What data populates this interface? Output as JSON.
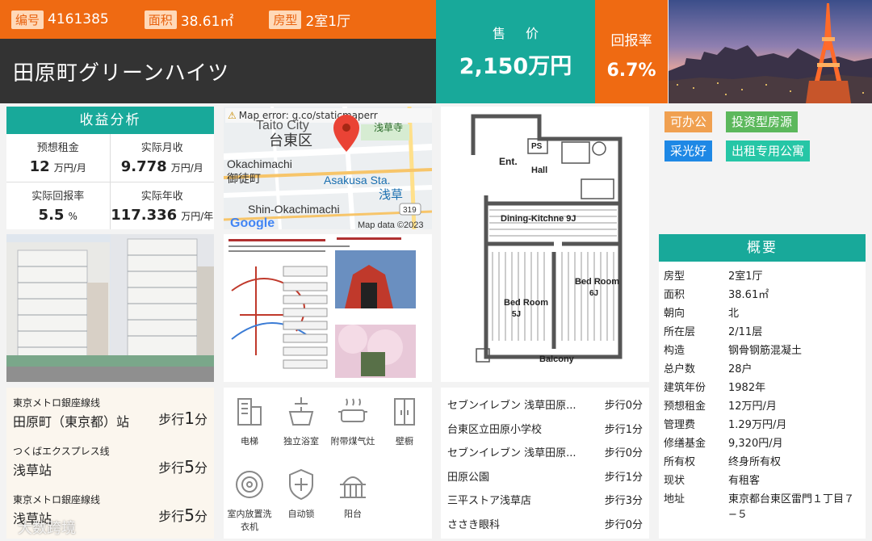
{
  "header": {
    "id_label": "编号",
    "id_value": "4161385",
    "area_label": "面积",
    "area_value": "38.61㎡",
    "layout_label": "房型",
    "layout_value": "2室1厅",
    "name": "田原町グリーンハイツ"
  },
  "price": {
    "label": "售 价",
    "value": "2,150万円"
  },
  "yield": {
    "label": "回报率",
    "value": "6.7%"
  },
  "income": {
    "title": "收益分析",
    "items": [
      {
        "label": "预想租金",
        "value": "12",
        "unit": "万円/月"
      },
      {
        "label": "实际月收",
        "value": "9.778",
        "unit": "万円/月"
      },
      {
        "label": "实际回报率",
        "value": "5.5",
        "unit": "%"
      },
      {
        "label": "实际年收",
        "value": "117.336",
        "unit": "万円/年"
      }
    ]
  },
  "stations": [
    {
      "line": "東京メトロ銀座線线",
      "name": "田原町（東京都）站",
      "walk_prefix": "步行",
      "walk_num": "1",
      "walk_unit": "分"
    },
    {
      "line": "つくばエクスプレス线",
      "name": "浅草站",
      "walk_prefix": "步行",
      "walk_num": "5",
      "walk_unit": "分"
    },
    {
      "line": "東京メトロ銀座線线",
      "name": "浅草站",
      "walk_prefix": "步行",
      "walk_num": "5",
      "walk_unit": "分"
    }
  ],
  "map": {
    "error": "Map error: g.co/staticmaperr",
    "labels": [
      "Taito City",
      "台東区",
      "浅草寺",
      "Okachimachi",
      "御徒町",
      "Asakusa Sta.",
      "浅草",
      "Shin-Okachimachi",
      "319",
      "Google",
      "Map data ©2023"
    ]
  },
  "amenities": [
    {
      "label": "电梯",
      "icon": "elevator-icon"
    },
    {
      "label": "独立浴室",
      "icon": "shower-icon"
    },
    {
      "label": "附带煤气灶",
      "icon": "gas-stove-icon"
    },
    {
      "label": "壁橱",
      "icon": "closet-icon"
    },
    {
      "label": "室内放置洗衣机",
      "icon": "washing-machine-icon"
    },
    {
      "label": "自动锁",
      "icon": "auto-lock-icon"
    },
    {
      "label": "阳台",
      "icon": "balcony-icon"
    }
  ],
  "floorplan": {
    "labels": [
      "PS",
      "Ent.",
      "Hall",
      "Dining-Kitchne 9J",
      "Bed Room",
      "6J",
      "Bed Room",
      "5J",
      "Balcony"
    ]
  },
  "nearby": [
    {
      "name": "セブンイレブン 浅草田原...",
      "walk": "步行0分"
    },
    {
      "name": "台東区立田原小学校",
      "walk": "步行1分"
    },
    {
      "name": "セブンイレブン 浅草田原...",
      "walk": "步行0分"
    },
    {
      "name": "田原公園",
      "walk": "步行1分"
    },
    {
      "name": "三平ストア浅草店",
      "walk": "步行3分"
    },
    {
      "name": "ささき眼科",
      "walk": "步行0分"
    }
  ],
  "tags": [
    {
      "label": "可办公",
      "color": "#f0a050"
    },
    {
      "label": "投资型房源",
      "color": "#5cb85c"
    },
    {
      "label": "采光好",
      "color": "#1e88e5"
    },
    {
      "label": "出租专用公寓",
      "color": "#26c6a6"
    }
  ],
  "overview": {
    "title": "概要",
    "rows": [
      {
        "k": "房型",
        "v": "2室1厅"
      },
      {
        "k": "面积",
        "v": "38.61㎡"
      },
      {
        "k": "朝向",
        "v": "北"
      },
      {
        "k": "所在层",
        "v": "2/11层"
      },
      {
        "k": "构造",
        "v": "钢骨钢筋混凝土"
      },
      {
        "k": "总户数",
        "v": "28户"
      },
      {
        "k": "建筑年份",
        "v": "1982年"
      },
      {
        "k": "预想租金",
        "v": "12万円/月"
      },
      {
        "k": "管理费",
        "v": "1.29万円/月"
      },
      {
        "k": "修缮基金",
        "v": "9,320円/月"
      },
      {
        "k": "所有权",
        "v": "终身所有权"
      },
      {
        "k": "现状",
        "v": "有租客"
      },
      {
        "k": "地址",
        "v": "東京都台東区雷門１丁目７−５"
      }
    ]
  },
  "watermark": "大数跨境",
  "colors": {
    "teal": "#18a99a",
    "orange": "#ef6a12",
    "dark": "#333333"
  }
}
